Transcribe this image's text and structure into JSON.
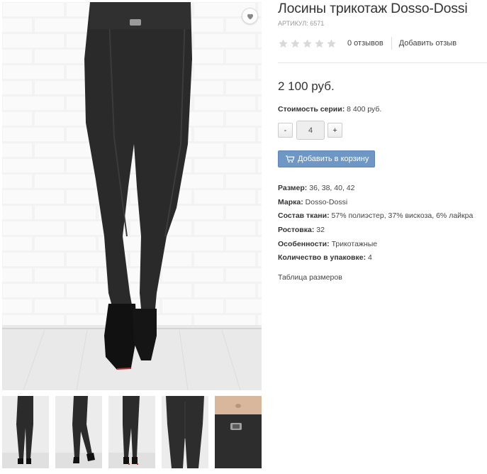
{
  "product": {
    "title": "Лосины трикотаж Dosso-Dossi",
    "sku_label": "АРТИКУЛ:",
    "sku_value": "6571",
    "rating": 0,
    "rating_max": 5,
    "reviews_count": "0 отзывов",
    "add_review": "Добавить отзыв",
    "price": "2 100 руб.",
    "series_label": "Стоимость серии:",
    "series_value": "8 400 руб.",
    "qty_minus": "-",
    "qty_value": "4",
    "qty_plus": "+",
    "add_to_cart": "Добавить в корзину",
    "properties": [
      {
        "label": "Размер:",
        "value": "36, 38, 40, 42"
      },
      {
        "label": "Марка:",
        "value": "Dosso-Dossi"
      },
      {
        "label": "Состав ткани:",
        "value": "57% полиэстер, 37% вискоза, 6% лайкра"
      },
      {
        "label": "Ростовка:",
        "value": "32"
      },
      {
        "label": "Особенности:",
        "value": "Трикотажные"
      },
      {
        "label": "Количество в упаковке:",
        "value": "4"
      }
    ],
    "size_table_link": "Таблица размеров"
  },
  "gallery": {
    "thumbnail_count": 5,
    "wishlist_icon": "heart-icon"
  },
  "colors": {
    "cart_button": "#6f97c6",
    "star_empty": "#d9d9d9",
    "text": "#333333",
    "muted": "#999999"
  }
}
